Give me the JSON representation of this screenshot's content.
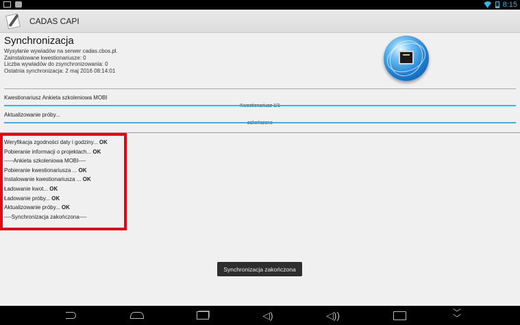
{
  "status_bar": {
    "time": "8:15"
  },
  "app": {
    "title": "CADAS CAPI"
  },
  "page": {
    "title": "Synchronizacja",
    "info_lines": [
      "Wysyłanie wywiadów na serwer cadas.cbos.pl.",
      "Zainstalowane kwestionariusze: 0",
      "Liczba wywiadów do zsynchronizowania: 0",
      "Ostatnia synchronizacja: 2 maj 2016 08:14:01"
    ]
  },
  "questionnaire": {
    "label": "Kwestionariusz Ankieta szkoleniowa MOBI",
    "progress_text": "Kwestionariusz 1/1",
    "progress_fraction": 1.0
  },
  "sample": {
    "label": "Aktualizowanie próby...",
    "progress_text": "zakończone",
    "progress_fraction": 1.0
  },
  "log": [
    {
      "text": "Weryfikacja zgodności daty i godziny... ",
      "status": "OK"
    },
    {
      "text": "Pobieranie informacji o projektach... ",
      "status": "OK"
    },
    {
      "text": "-----Ankieta szkoleniowa MOBI----",
      "status": ""
    },
    {
      "text": "Pobieranie kwestionariusza ... ",
      "status": "OK"
    },
    {
      "text": "Instalowanie kwestionariusza ... ",
      "status": "OK"
    },
    {
      "text": "Ładowanie kwot... ",
      "status": "OK"
    },
    {
      "text": "Ładowanie próby... ",
      "status": "OK"
    },
    {
      "text": "Aktualizowanie próby... ",
      "status": "OK"
    },
    {
      "text": "----Synchronizacja zakończona----",
      "status": ""
    }
  ],
  "toast": {
    "text": "Synchronizacja zakończona"
  },
  "colors": {
    "accent": "#33b5e5",
    "highlight_border": "#e30613"
  },
  "icons": [
    "gallery-icon",
    "camera-icon",
    "wifi-icon",
    "battery-icon",
    "app-icon",
    "network-globe-icon",
    "back-icon",
    "home-icon",
    "recent-apps-icon",
    "volume-down-icon",
    "volume-up-icon",
    "screenshot-icon",
    "collapse-icon"
  ]
}
